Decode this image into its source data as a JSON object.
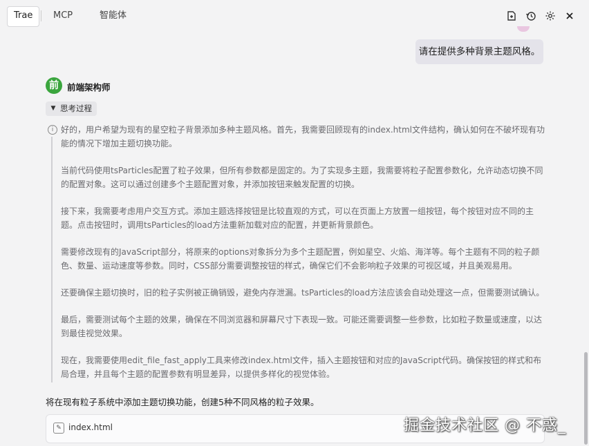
{
  "tabs": [
    {
      "label": "Trae"
    },
    {
      "label": "MCP"
    },
    {
      "label": "智能体"
    }
  ],
  "toolbar_icons": [
    "new-chat-icon",
    "history-icon",
    "gear-icon",
    "close-icon"
  ],
  "user_message": "请在提供多种背景主题风格。",
  "agent": {
    "avatar_char": "前",
    "name": "前端架构师",
    "avatar_color": "#3aa53d"
  },
  "thinking": {
    "toggle_label": "思考过程",
    "paragraphs": [
      "好的，用户希望为现有的星空粒子背景添加多种主题风格。首先，我需要回顾现有的index.html文件结构，确认如何在不破坏现有功能的情况下增加主题切换功能。",
      "当前代码使用tsParticles配置了粒子效果，但所有参数都是固定的。为了实现多主题，我需要将粒子配置参数化，允许动态切换不同的配置对象。这可以通过创建多个主题配置对象，并添加按钮来触发配置的切换。",
      "接下来，我需要考虑用户交互方式。添加主题选择按钮是比较直观的方式，可以在页面上方放置一组按钮，每个按钮对应不同的主题。点击按钮时，调用tsParticles的load方法重新加载对应的配置，并更新背景颜色。",
      "需要修改现有的JavaScript部分，将原来的options对象拆分为多个主题配置，例如星空、火焰、海洋等。每个主题有不同的粒子颜色、数量、运动速度等参数。同时，CSS部分需要调整按钮的样式，确保它们不会影响粒子效果的可视区域，并且美观易用。",
      "还要确保主题切换时，旧的粒子实例被正确销毁，避免内存泄漏。tsParticles的load方法应该会自动处理这一点，但需要测试确认。",
      "最后，需要测试每个主题的效果，确保在不同浏览器和屏幕尺寸下表现一致。可能还需要调整一些参数，比如粒子数量或速度，以达到最佳视觉效果。",
      "现在，我需要使用edit_file_fast_apply工具来修改index.html文件，插入主题按钮和对应的JavaScript代码。确保按钮的样式和布局合理，并且每个主题的配置参数有明显差异，以提供多样化的视觉体验。"
    ]
  },
  "summary": "将在现有粒子系统中添加主题切换功能，创建5种不同风格的粒子效果。",
  "file_card": {
    "filename": "index.html",
    "icon": "edit-file-icon"
  },
  "watermark": "掘金技术社区 @ 不惑_"
}
